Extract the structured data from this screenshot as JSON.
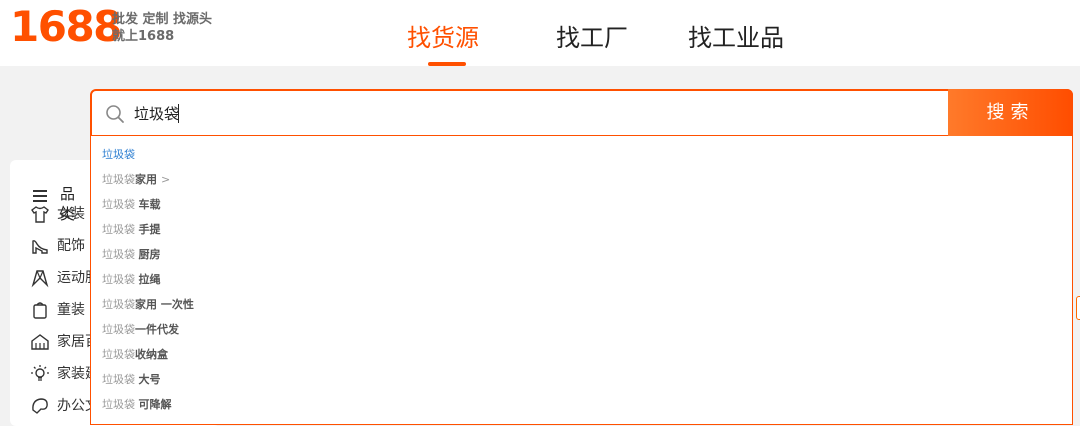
{
  "brand": {
    "logo_text": "1688",
    "slogan_line1": "批发 定制 找源头",
    "slogan_line2": "就上1688",
    "accent": "#ff5000"
  },
  "nav": {
    "tabs": [
      {
        "label": "找货源",
        "active": true
      },
      {
        "label": "找工厂",
        "active": false
      },
      {
        "label": "找工业品",
        "active": false
      }
    ]
  },
  "search": {
    "value": "垃圾袋",
    "button_label": "搜索"
  },
  "suggestions": [
    {
      "query": "垃圾袋",
      "ext": ""
    },
    {
      "query": "垃圾袋",
      "ext": "家用",
      "arrow": ">"
    },
    {
      "query": "垃圾袋 ",
      "ext": "车载"
    },
    {
      "query": "垃圾袋 ",
      "ext": "手提"
    },
    {
      "query": "垃圾袋 ",
      "ext": "厨房"
    },
    {
      "query": "垃圾袋 ",
      "ext": "拉绳"
    },
    {
      "query": "垃圾袋",
      "ext": "家用 一次性"
    },
    {
      "query": "垃圾袋",
      "ext": "一件代发"
    },
    {
      "query": "垃圾袋",
      "ext": "收纳盒"
    },
    {
      "query": "垃圾袋 ",
      "ext": "大号"
    },
    {
      "query": "垃圾袋 ",
      "ext": "可降解"
    }
  ],
  "categories": {
    "header": "品类",
    "items": [
      {
        "label": "女装",
        "icon": "shirt-icon"
      },
      {
        "label": "配饰",
        "icon": "heel-icon"
      },
      {
        "label": "运动服",
        "icon": "sport-icon"
      },
      {
        "label": "童装",
        "icon": "kids-icon"
      },
      {
        "label": "家居百",
        "icon": "home-icon"
      },
      {
        "label": "家装建",
        "icon": "bulb-icon"
      },
      {
        "label": "办公文",
        "icon": "office-icon"
      }
    ]
  }
}
